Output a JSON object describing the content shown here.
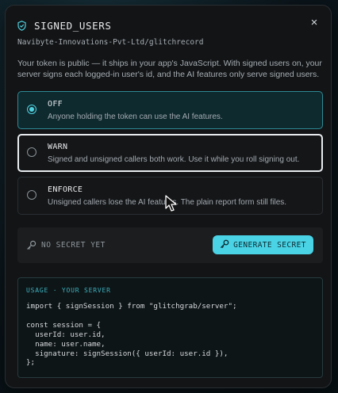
{
  "dialog": {
    "title": "SIGNED_USERS",
    "close_glyph": "×",
    "repo": "Navibyte-Innovations-Pvt-Ltd/glitchrecord",
    "description": "Your token is public — it ships in your app's JavaScript. With signed users on, your server signs each logged-in user's id, and the AI features only serve signed users.",
    "icon": "shield-check-icon"
  },
  "options": [
    {
      "label": "OFF",
      "description": "Anyone holding the token can use the AI features.",
      "selected": true
    },
    {
      "label": "WARN",
      "description": "Signed and unsigned callers both work. Use it while you roll signing out.",
      "selected": false,
      "focused": true
    },
    {
      "label": "ENFORCE",
      "description": "Unsigned callers lose the AI features. The plain report form still files.",
      "selected": false
    }
  ],
  "secret": {
    "status": "NO SECRET YET",
    "button_label": "GENERATE SECRET",
    "icon": "key-icon"
  },
  "code": {
    "heading": "USAGE · YOUR SERVER",
    "lines": [
      "import { signSession } from \"glitchgrab/server\";",
      "",
      "const session = {",
      "  userId: user.id,",
      "  name: user.name,",
      "  signature: signSession({ userId: user.id }),",
      "};"
    ]
  },
  "colors": {
    "accent": "#4ad3e5",
    "selected_border": "#2e8a95",
    "modal_bg": "#121416"
  }
}
